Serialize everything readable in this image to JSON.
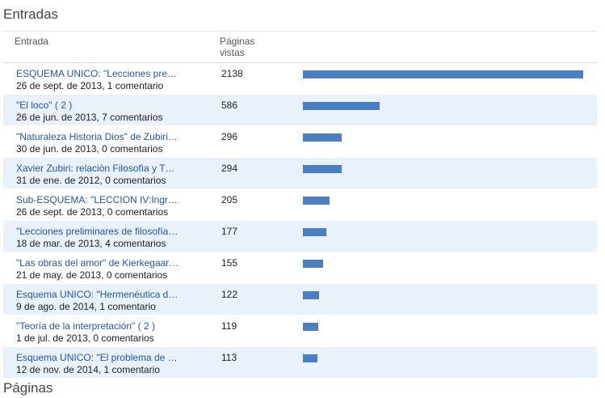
{
  "sections": {
    "entries_title": "Entradas",
    "pages_title": "Páginas"
  },
  "header": {
    "col_entry": "Entrada",
    "col_views_line1": "Páginas",
    "col_views_line2": "vistas"
  },
  "colors": {
    "bar": "#4a7fc1",
    "link": "#1f56b5",
    "row_alt": "#e9f1fb"
  },
  "max_views": 2138,
  "rows": [
    {
      "title": "ESQUEMA UNICO: \"Lecciones pre…",
      "meta": "26 de sept. de 2013, 1 comentario",
      "views": 2138
    },
    {
      "title": "\"El loco\" ( 2 )",
      "meta": "26 de jun. de 2013, 7 comentarios",
      "views": 586
    },
    {
      "title": "\"Naturaleza Historia Dios\" de Zubiri…",
      "meta": "30 de jun. de 2013, 0 comentarios",
      "views": 296
    },
    {
      "title": "Xavier Zubiri: relaciòn Filosofìa y T…",
      "meta": "31 de ene. de 2012, 0 comentarios",
      "views": 294
    },
    {
      "title": "Sub-ESQUEMA: \"LECCION IV:Ingr…",
      "meta": "26 de sept. de 2013, 0 comentarios",
      "views": 205
    },
    {
      "title": "\"Lecciones preliminares de filosofía…",
      "meta": "18 de mar. de 2013, 4 comentarios",
      "views": 177
    },
    {
      "title": "\"Las obras del amor\" de Kierkegaar…",
      "meta": "21 de may. de 2013, 0 comentarios",
      "views": 155
    },
    {
      "title": "Esquema UNICO: \"Hermenéutica d…",
      "meta": "9 de ago. de 2014, 1 comentario",
      "views": 122
    },
    {
      "title": "\"Teoría de la interpretación\" ( 2 )",
      "meta": "1 de jul. de 2013, 0 comentarios",
      "views": 119
    },
    {
      "title": "Esquema UNICO: \"El problema de …",
      "meta": "12 de nov. de 2014, 1 comentario",
      "views": 113
    }
  ]
}
